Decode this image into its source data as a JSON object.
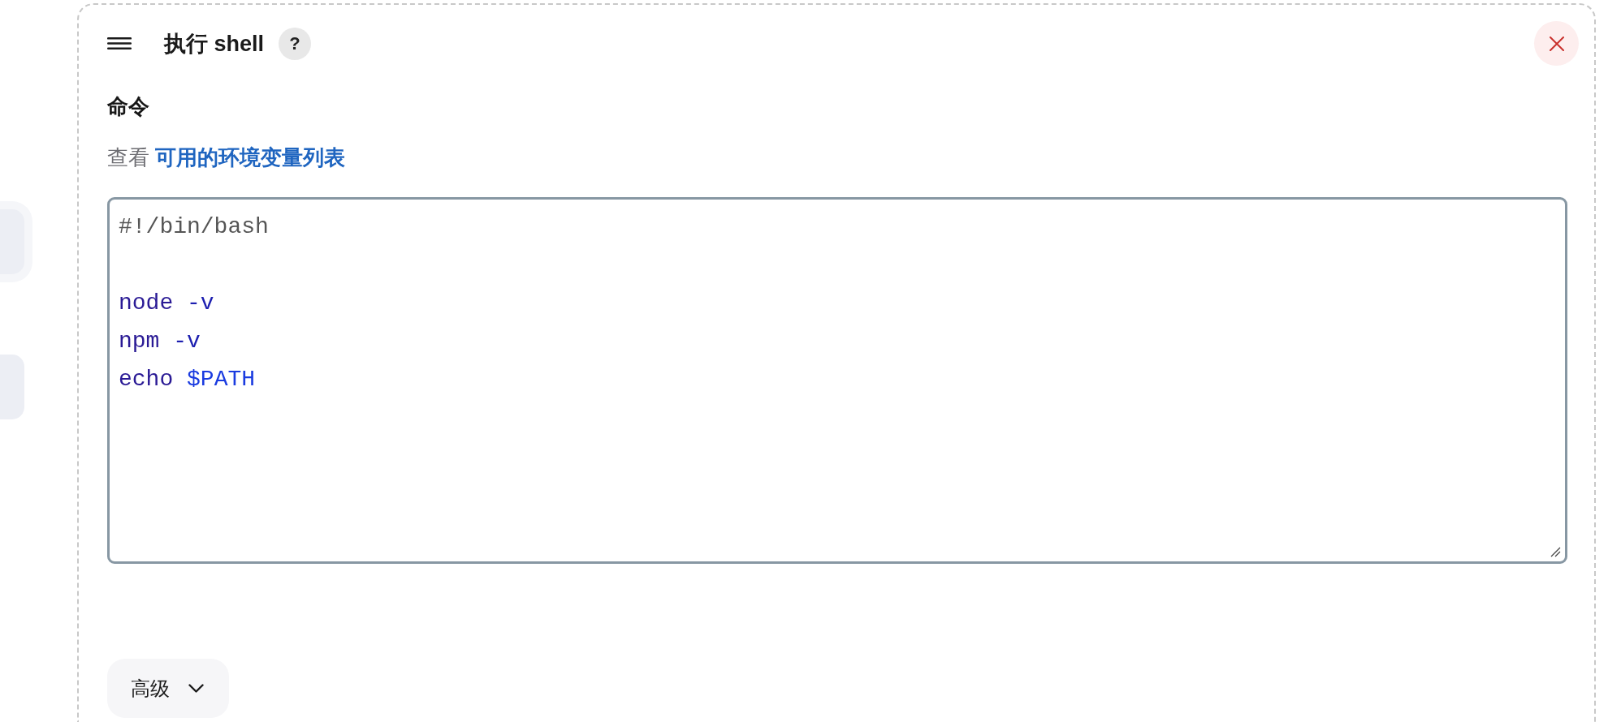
{
  "sidebar": {
    "items": [
      {
        "selected": true
      },
      {
        "selected": false
      }
    ]
  },
  "step": {
    "title": "执行 shell",
    "help_label": "?",
    "field": {
      "label": "命令",
      "hint": "查看",
      "hint_link": "可用的环境变量列表",
      "editor": {
        "lines": [
          {
            "kind": "code",
            "tokens": [
              {
                "text": "#!/bin/bash",
                "kind": "comment"
              }
            ]
          },
          {
            "kind": "blank"
          },
          {
            "kind": "code",
            "tokens": [
              {
                "text": "node",
                "kind": "word"
              },
              {
                "text": "-v",
                "kind": "option"
              }
            ]
          },
          {
            "kind": "code",
            "tokens": [
              {
                "text": "npm",
                "kind": "word"
              },
              {
                "text": "-v",
                "kind": "option"
              }
            ]
          },
          {
            "kind": "code",
            "tokens": [
              {
                "text": "echo",
                "kind": "word"
              },
              {
                "text": "$PATH",
                "kind": "variable"
              }
            ]
          }
        ]
      }
    },
    "advanced": {
      "label": "高级",
      "expanded": false
    }
  }
}
